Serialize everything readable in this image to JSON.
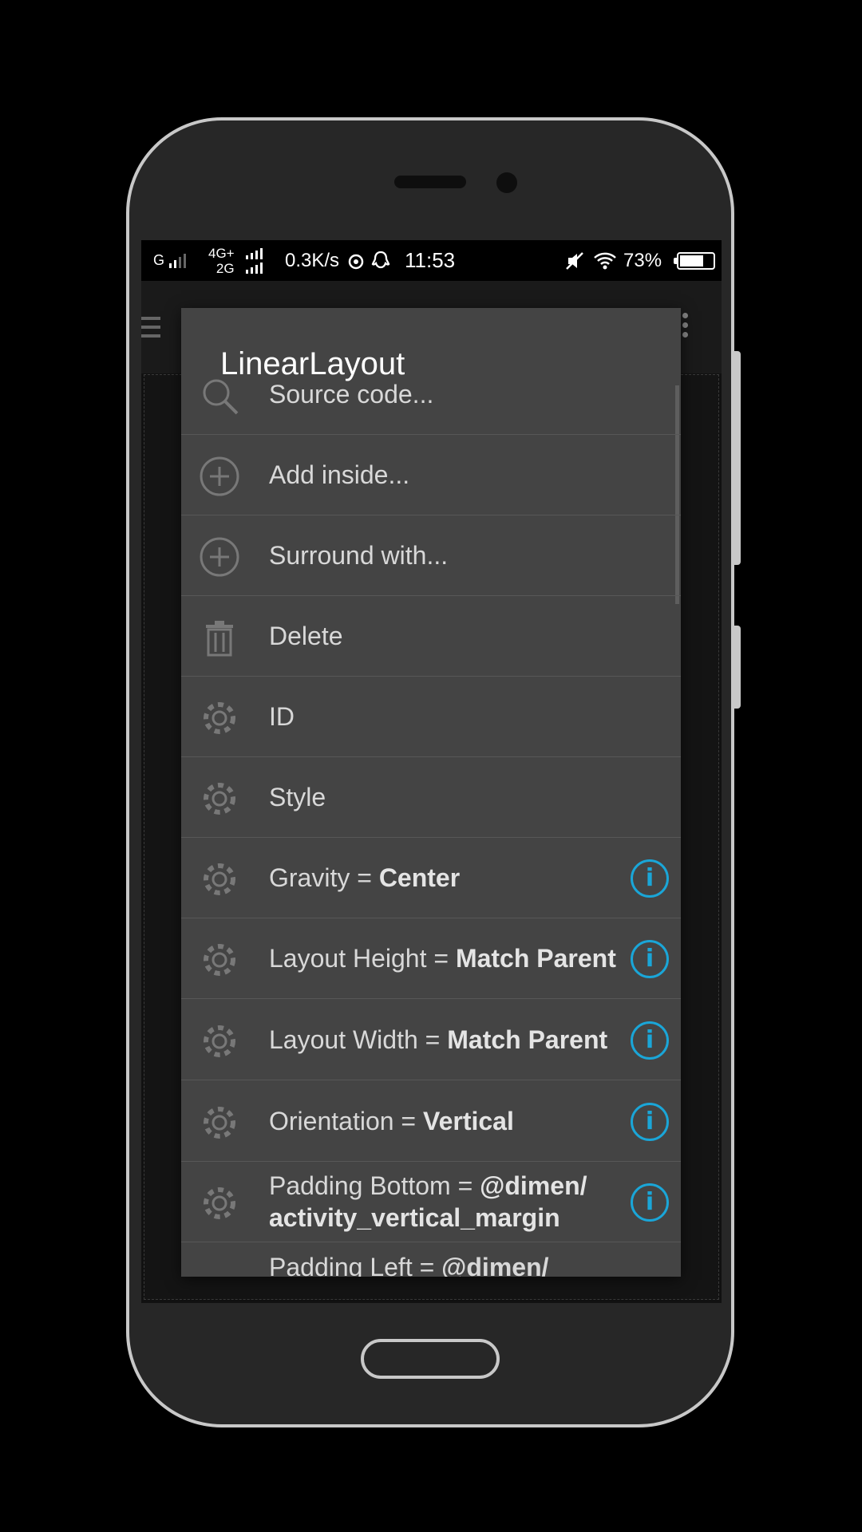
{
  "status_bar": {
    "network_1": "G",
    "network_2_top": "4G+",
    "network_2_bottom": "2G",
    "speed": "0.3K/s",
    "time": "11:53",
    "battery_pct": "73%",
    "battery_level": 0.73
  },
  "dialog": {
    "title": "LinearLayout",
    "items": [
      {
        "icon": "search-icon",
        "label": "Source code..."
      },
      {
        "icon": "add-circle-icon",
        "label": "Add inside..."
      },
      {
        "icon": "add-circle-icon",
        "label": "Surround with..."
      },
      {
        "icon": "trash-icon",
        "label": "Delete"
      },
      {
        "icon": "gear-icon",
        "label": "ID"
      },
      {
        "icon": "gear-icon",
        "label": "Style"
      },
      {
        "icon": "gear-icon",
        "label": "Gravity = ",
        "value": "Center",
        "info": true
      },
      {
        "icon": "gear-icon",
        "label": "Layout Height = ",
        "value": "Match Parent",
        "info": true
      },
      {
        "icon": "gear-icon",
        "label": "Layout Width = ",
        "value": "Match Parent",
        "info": true
      },
      {
        "icon": "gear-icon",
        "label": "Orientation = ",
        "value": "Vertical",
        "info": true
      },
      {
        "icon": "gear-icon",
        "label": "Padding Bottom = ",
        "value": "@dimen/ activity_vertical_margin",
        "info": true
      }
    ],
    "partial_item": {
      "label": "Padding Left = ",
      "value": "@dimen/"
    },
    "info_glyph": "i"
  },
  "colors": {
    "dialog_bg": "#444444",
    "info_accent": "#1aa6d8",
    "phone_frame": "#c8c8c8"
  }
}
